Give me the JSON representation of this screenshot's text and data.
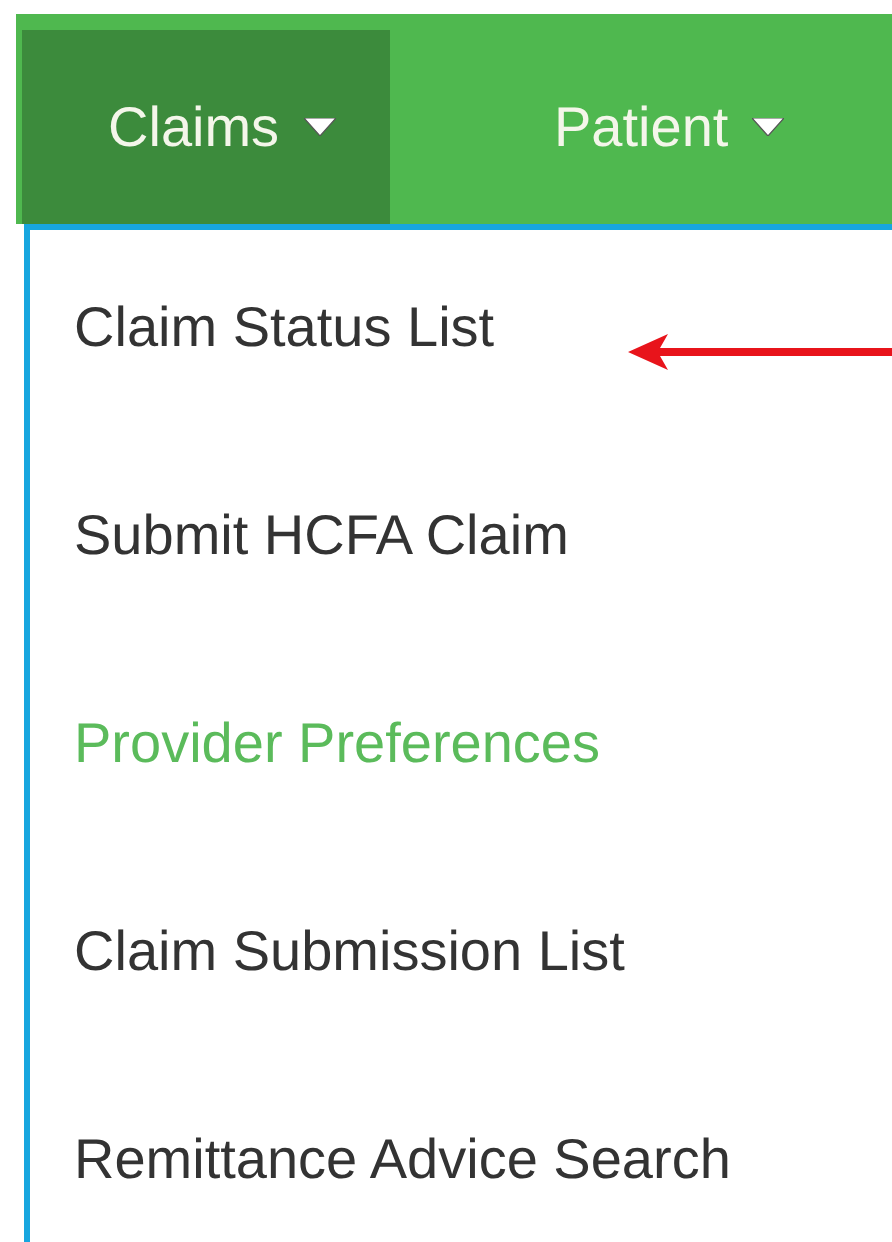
{
  "nav_tabs": [
    {
      "label": "Claims",
      "selected": true
    },
    {
      "label": "Patient",
      "selected": false
    }
  ],
  "menu_items": [
    {
      "label": "Claim Status List",
      "highlighted": false
    },
    {
      "label": "Submit HCFA Claim",
      "highlighted": false
    },
    {
      "label": "Provider Preferences",
      "highlighted": true
    },
    {
      "label": "Claim Submission List",
      "highlighted": false
    },
    {
      "label": "Remittance Advice Search",
      "highlighted": false
    }
  ]
}
